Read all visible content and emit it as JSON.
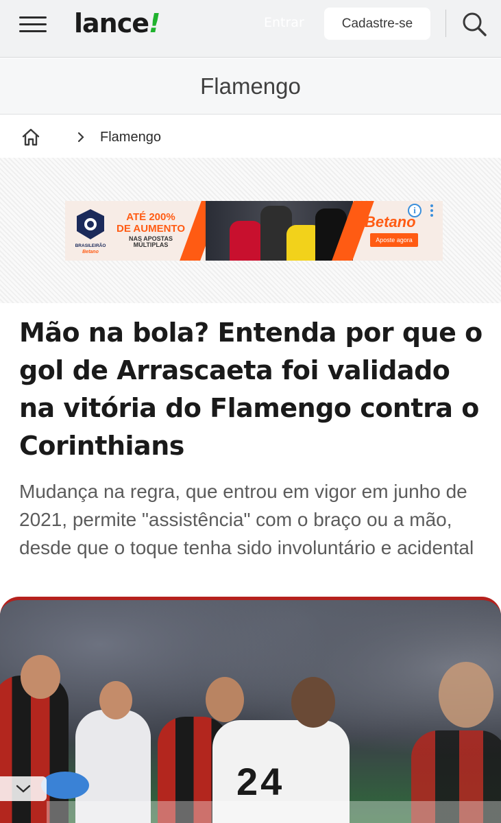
{
  "header": {
    "logo_text": "lance",
    "logo_bang": "!",
    "login_label": "Entrar",
    "signup_label": "Cadastre-se",
    "menu_icon": "hamburger-menu-icon",
    "search_icon": "search-icon",
    "accent_color": "#1fb22d"
  },
  "section": {
    "title": "Flamengo"
  },
  "breadcrumb": {
    "home_icon": "home-icon",
    "separator_icon": "chevron-right-icon",
    "current": "Flamengo"
  },
  "ad": {
    "league_label": "BRASILEIRÃO",
    "league_sponsor": "Betano",
    "promo_line1": "ATÉ 200%",
    "promo_line2": "DE AUMENTO",
    "promo_line3": "NAS APOSTAS MÚLTIPLAS",
    "brand": "Betano",
    "cta": "Aposte agora",
    "info_glyph": "i",
    "brand_color": "#ff5b13"
  },
  "article": {
    "headline": "Mão na bola? Entenda por que o gol de Arrascaeta foi validado na vitória do Flamengo contra o Corinthians",
    "subtitle": "Mudança na regra, que entrou em vigor em junho de 2021, permite \"assistência\" com o braço ou a mão, desde que o toque tenha sido involuntário e acidental",
    "hero_number": "24",
    "expand_icon": "chevron-down-icon",
    "hero_border_color": "#b5211d"
  }
}
